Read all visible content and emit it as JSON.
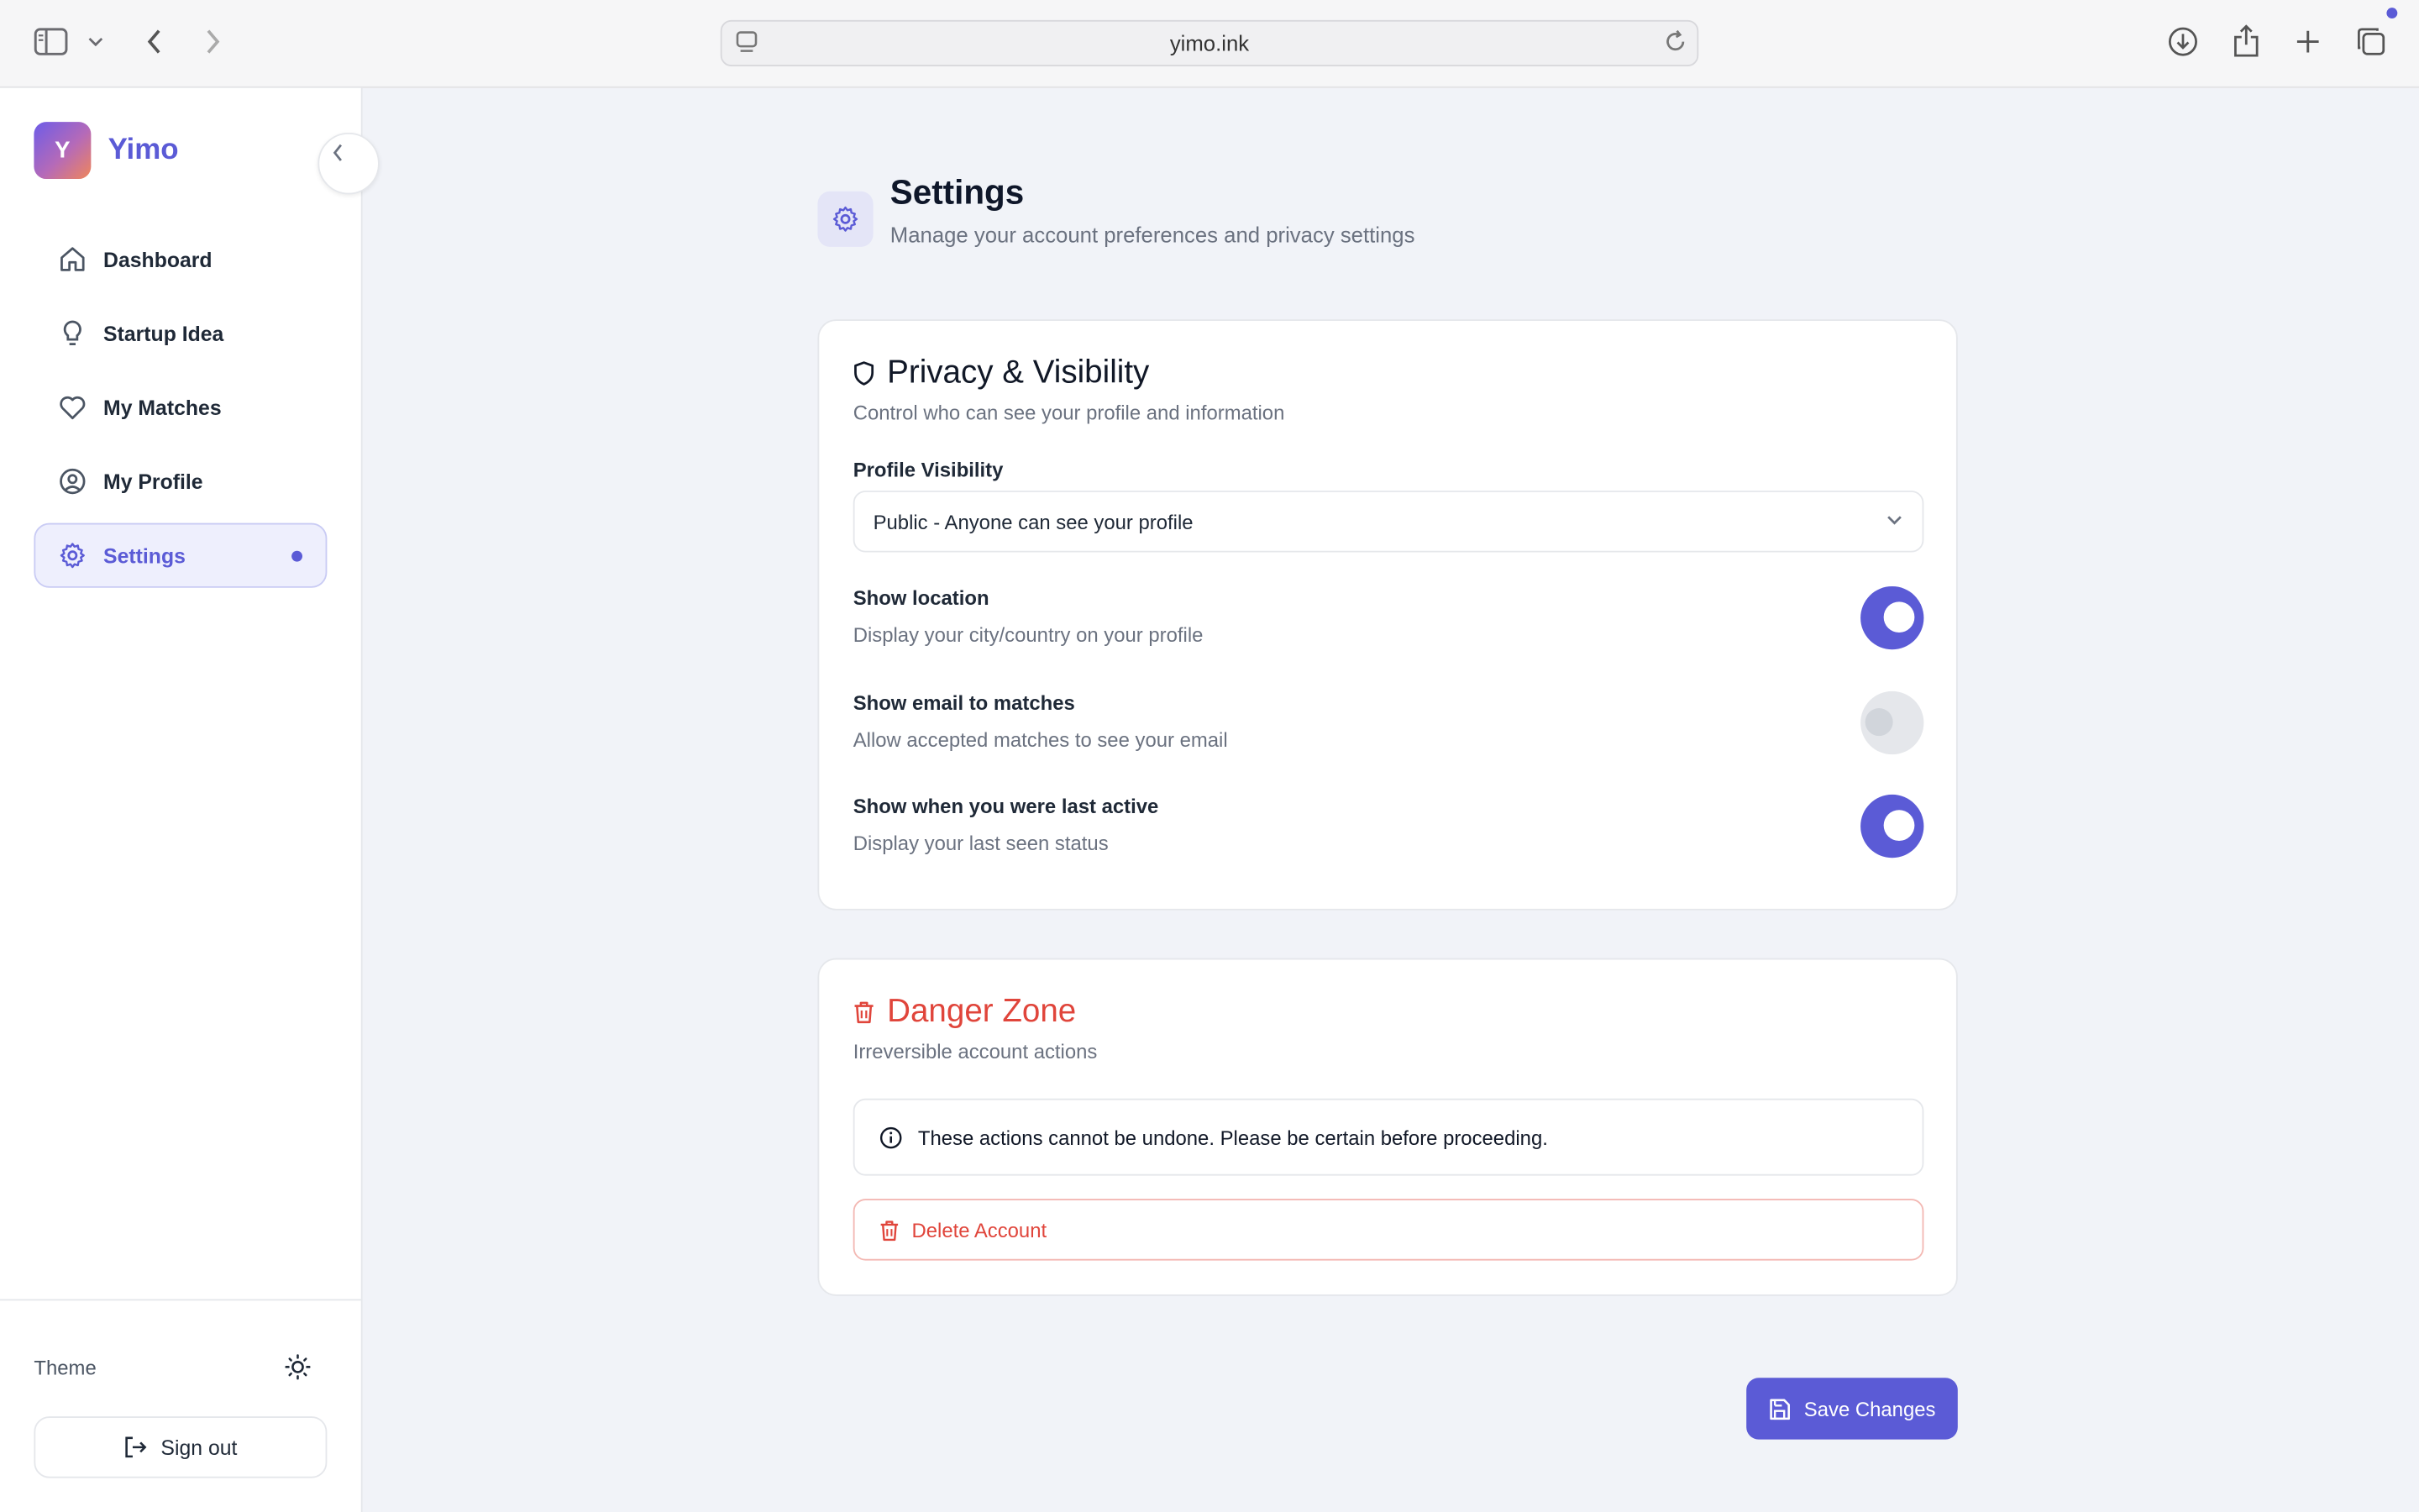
{
  "browser": {
    "url": "yimo.ink"
  },
  "brand": {
    "initial": "Y",
    "name": "Yimo"
  },
  "sidebar": {
    "items": [
      {
        "label": "Dashboard",
        "icon": "home-icon"
      },
      {
        "label": "Startup Idea",
        "icon": "lightbulb-icon"
      },
      {
        "label": "My Matches",
        "icon": "heart-icon"
      },
      {
        "label": "My Profile",
        "icon": "user-circle-icon"
      },
      {
        "label": "Settings",
        "icon": "gear-icon",
        "active": true
      }
    ],
    "theme_label": "Theme",
    "sign_out_label": "Sign out"
  },
  "page": {
    "title": "Settings",
    "subtitle": "Manage your account preferences and privacy settings"
  },
  "privacy": {
    "title": "Privacy & Visibility",
    "description": "Control who can see your profile and information",
    "visibility_label": "Profile Visibility",
    "visibility_value": "Public - Anyone can see your profile",
    "toggles": [
      {
        "label": "Show location",
        "description": "Display your city/country on your profile",
        "on": true
      },
      {
        "label": "Show email to matches",
        "description": "Allow accepted matches to see your email",
        "on": false
      },
      {
        "label": "Show when you were last active",
        "description": "Display your last seen status",
        "on": true
      }
    ]
  },
  "danger": {
    "title": "Danger Zone",
    "description": "Irreversible account actions",
    "warning": "These actions cannot be undone. Please be certain before proceeding.",
    "delete_label": "Delete Account"
  },
  "actions": {
    "save_label": "Save Changes"
  },
  "colors": {
    "accent": "#5b5bd6",
    "danger": "#e0453b"
  }
}
